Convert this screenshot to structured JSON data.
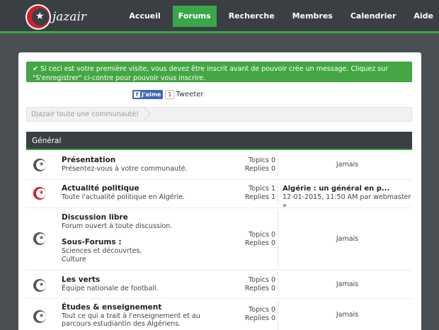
{
  "header": {
    "logo_text": "jazair",
    "nav": [
      "Accueil",
      "Forums",
      "Recherche",
      "Membres",
      "Calendrier",
      "Aide"
    ],
    "active_nav": "Forums"
  },
  "notice": {
    "icon": "check-icon",
    "text": "Si ceci est votre première visite, vous devez être inscrit avant de pouvoir crée un message. Cliquez sur \"S'enregistrer\" ci-contre pour pouvoir vous inscrire."
  },
  "social": {
    "fb_label": "J'aime",
    "fb_count": "1",
    "tweet_label": "Tweeter"
  },
  "breadcrumb": "Djazair toute une communauté!",
  "category": "Général",
  "forums": [
    {
      "title": "Présentation",
      "description": "Présentez-vous à votre communauté.",
      "topics": "Topics 0",
      "replies": "Replies 0",
      "last": "Jamais",
      "icon": "crescent-star-icon"
    },
    {
      "title": "Actualité politique",
      "description": "Toute l'actualité politique en Algérie.",
      "topics": "Topics 1",
      "replies": "Replies 1",
      "last_title": "Algérie : un général en p...",
      "last_date": "12-01-2015, 11:50 AM",
      "last_by": "par webmaster »",
      "icon": "crescent-star-icon"
    },
    {
      "title": "Discussion libre",
      "description": "Forum ouvert à toute discussion.",
      "subforums_label": "Sous-Forums :",
      "subforums": [
        "Sciences et découvrtes,",
        "Culture"
      ],
      "topics": "Topics 0",
      "replies": "Replies 0",
      "last": "Jamais",
      "icon": "crescent-star-icon"
    },
    {
      "title": "Les verts",
      "description": "Équipe nationale de football.",
      "topics": "Topics 0",
      "replies": "Replies 0",
      "last": "Jamais",
      "icon": "crescent-star-icon"
    },
    {
      "title": "Études & enseignement",
      "description": "Tout ce qui a trait à l'enseignement et au parcours estudiantin des Algériens.",
      "topics": "Topics 0",
      "replies": "Replies 0",
      "last": "Jamais",
      "icon": "crescent-star-icon"
    }
  ],
  "colors": {
    "header_bg": "#3a3f44",
    "accent_green": "#3aa64a",
    "flag_red": "#d0202a",
    "page_bg": "#4a4f54"
  }
}
